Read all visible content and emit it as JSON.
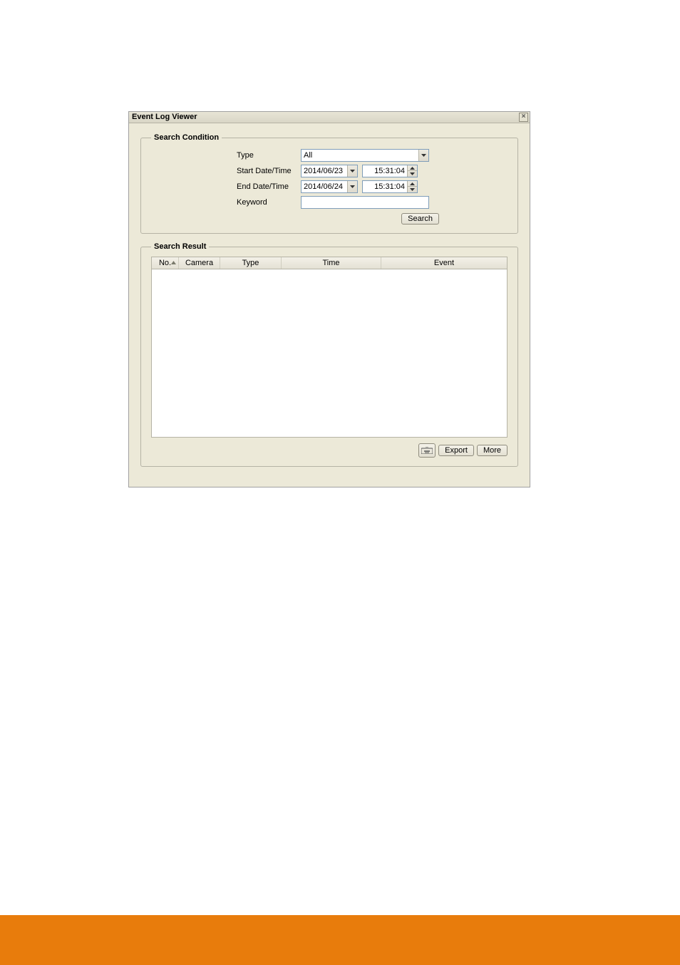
{
  "window": {
    "title": "Event Log Viewer"
  },
  "search_condition": {
    "legend": "Search Condition",
    "labels": {
      "type": "Type",
      "start": "Start Date/Time",
      "end": "End Date/Time",
      "keyword": "Keyword"
    },
    "type_value": "All",
    "start_date": "2014/06/23",
    "start_time": "15:31:04",
    "end_date": "2014/06/24",
    "end_time": "15:31:04",
    "keyword_value": "",
    "search_button": "Search"
  },
  "search_result": {
    "legend": "Search Result",
    "columns": {
      "no": "No.",
      "camera": "Camera",
      "type": "Type",
      "time": "Time",
      "event": "Event"
    }
  },
  "buttons": {
    "export": "Export",
    "more": "More"
  }
}
